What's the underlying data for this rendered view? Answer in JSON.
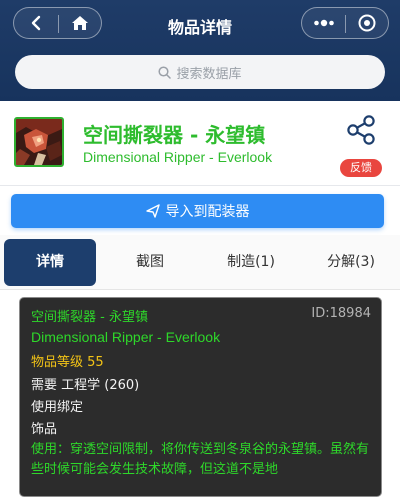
{
  "header": {
    "title": "物品详情",
    "search_placeholder": "搜索数据库"
  },
  "item": {
    "name_cn": "空间撕裂器 - 永望镇",
    "name_en": "Dimensional Ripper - Everlook",
    "quality_color": "#2ebc2e"
  },
  "report_badge": "反馈",
  "import_button": "导入到配装器",
  "tabs": [
    {
      "label": "详情",
      "active": true
    },
    {
      "label": "截图",
      "active": false
    },
    {
      "label": "制造(1)",
      "active": false
    },
    {
      "label": "分解(3)",
      "active": false
    }
  ],
  "tooltip": {
    "name_cn": "空间撕裂器 - 永望镇",
    "id": "ID:18984",
    "name_en": "Dimensional Ripper - Everlook",
    "item_level": "物品等级 55",
    "requires": "需要 工程学 (260)",
    "bind": "使用绑定",
    "slot": "饰品",
    "use_text": "使用：穿透空间限制，将你传送到冬泉谷的永望镇。虽然有些时候可能会发生技术故障，但这道不是地"
  },
  "colors": {
    "header_bg": "#1f3c68",
    "accent_blue": "#2e8cf3",
    "active_tab": "#1d3e6d",
    "badge_red": "#e9463f",
    "uncommon_green": "#2ed82a",
    "item_level_yellow": "#f2c316"
  },
  "icons": [
    "back-icon",
    "home-icon",
    "more-icon",
    "target-icon",
    "search-icon",
    "share-icon",
    "send-icon"
  ]
}
